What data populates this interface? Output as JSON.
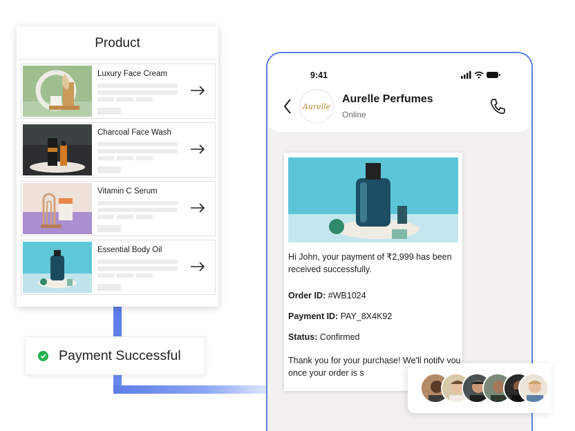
{
  "product_panel": {
    "title": "Product",
    "items": [
      {
        "name": "Luxury Face Cream",
        "thumb": "face-cream-image"
      },
      {
        "name": "Charcoal Face Wash",
        "thumb": "face-wash-image"
      },
      {
        "name": "Vitamin C Serum",
        "thumb": "serum-image"
      },
      {
        "name": "Essential Body Oil",
        "thumb": "body-oil-image"
      }
    ]
  },
  "payment": {
    "label": "Payment Successful",
    "icon": "check-circle-icon",
    "color": "#22b14c"
  },
  "phone": {
    "time": "9:41",
    "contact_name": "Aurelle Perfumes",
    "contact_status": "Online",
    "logo_text": "Aurelle",
    "message": {
      "line1": "Hi John, your payment of ₹2,999 has been received successfully.",
      "order_label": "Order ID:",
      "order_value": " #WB1024",
      "payment_label": "Payment ID:",
      "payment_value": " PAY_8X4K92",
      "status_label": "Status:",
      "status_value": " Confirmed",
      "thanks": "Thank you for your purchase! We'll notify you once your order is s"
    }
  },
  "colors": {
    "accent": "#5b7ee6",
    "success": "#22b14c"
  }
}
